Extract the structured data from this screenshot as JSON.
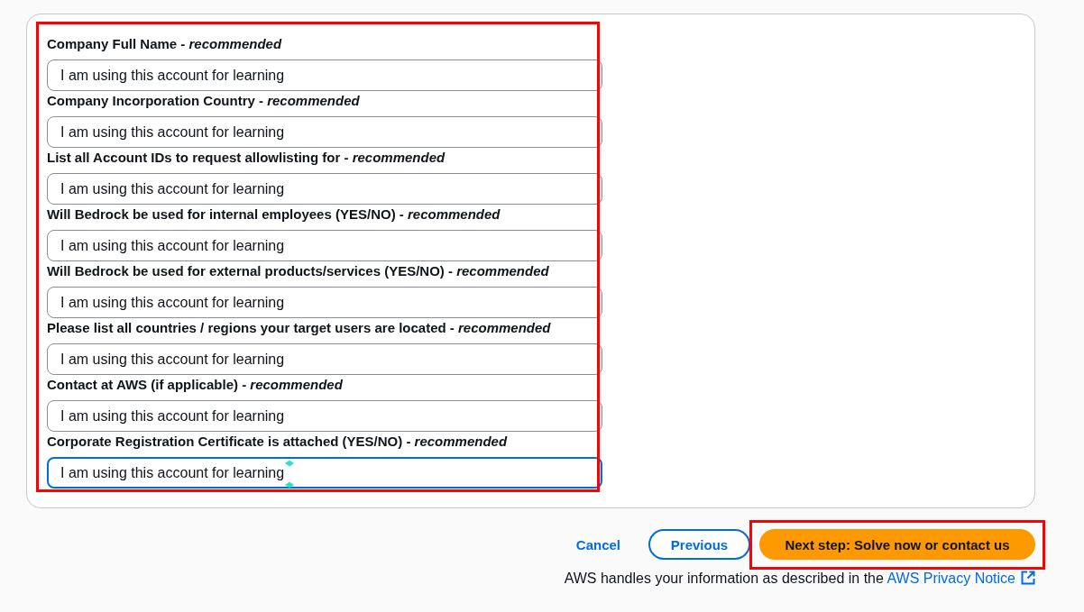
{
  "form": {
    "highlighted": true,
    "fields": [
      {
        "label": "Company Full Name - *recommended*",
        "value": "I am using this account for learning",
        "focused": false
      },
      {
        "label": "Company Incorporation Country - *recommended*",
        "value": "I am using this account for learning",
        "focused": false
      },
      {
        "label": "List all Account IDs to request allowlisting for - *recommended*",
        "value": "I am using this account for learning",
        "focused": false
      },
      {
        "label": "Will Bedrock be used for internal employees (YES/NO) - *recommended*",
        "value": "I am using this account for learning",
        "focused": false
      },
      {
        "label": "Will Bedrock be used for external products/services (YES/NO) - *recommended*",
        "value": "I am using this account for learning",
        "focused": false
      },
      {
        "label": "Please list all countries / regions your target users are located - *recommended*",
        "value": "I am using this account for learning",
        "focused": false
      },
      {
        "label": "Contact at AWS (if applicable) - *recommended*",
        "value": "I am using this account for learning",
        "focused": false
      },
      {
        "label": "Corporate Registration Certificate is attached (YES/NO) - *recommended*",
        "value": "I am using this account for learning",
        "focused": true
      }
    ]
  },
  "actions": {
    "cancel": "Cancel",
    "previous": "Previous",
    "next": {
      "label": "Next step: Solve now or contact us",
      "highlighted": true
    }
  },
  "footer": {
    "text": "AWS handles your information as described in the",
    "link": "AWS Privacy Notice"
  }
}
